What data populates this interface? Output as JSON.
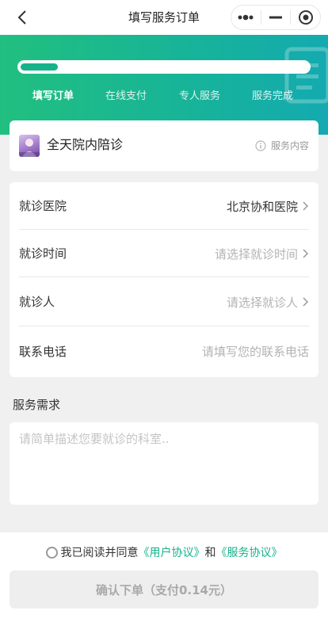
{
  "nav": {
    "title": "填写服务订单",
    "back_icon": "chevron-left-icon",
    "more_icon": "more-dots-icon",
    "minimize_icon": "minimize-icon",
    "close_icon": "target-close-icon"
  },
  "header": {
    "progress_fraction": 0.13,
    "steps": [
      {
        "label": "填写订单",
        "active": true
      },
      {
        "label": "在线支付",
        "active": false
      },
      {
        "label": "专人服务",
        "active": false
      },
      {
        "label": "服务完成",
        "active": false
      }
    ]
  },
  "service": {
    "name": "全天院内陪诊",
    "info_label": "服务内容",
    "info_icon": "info-circle-icon"
  },
  "form": {
    "hospital": {
      "label": "就诊医院",
      "value": "北京协和医院"
    },
    "time": {
      "label": "就诊时间",
      "placeholder": "请选择就诊时间"
    },
    "patient": {
      "label": "就诊人",
      "placeholder": "请选择就诊人"
    },
    "phone": {
      "label": "联系电话",
      "placeholder": "请填写您的联系电话"
    }
  },
  "demand": {
    "title": "服务需求",
    "placeholder": "请简单描述您要就诊的科室.."
  },
  "footer": {
    "agree_prefix": "我已阅读并同意",
    "user_agreement": "《用户协议》",
    "and_text": "和",
    "service_agreement": "《服务协议》",
    "submit_label": "确认下单（支付0.14元）"
  },
  "colors": {
    "accent": "#16b28a",
    "header_start": "#21bf7f",
    "header_end": "#14aab0"
  }
}
